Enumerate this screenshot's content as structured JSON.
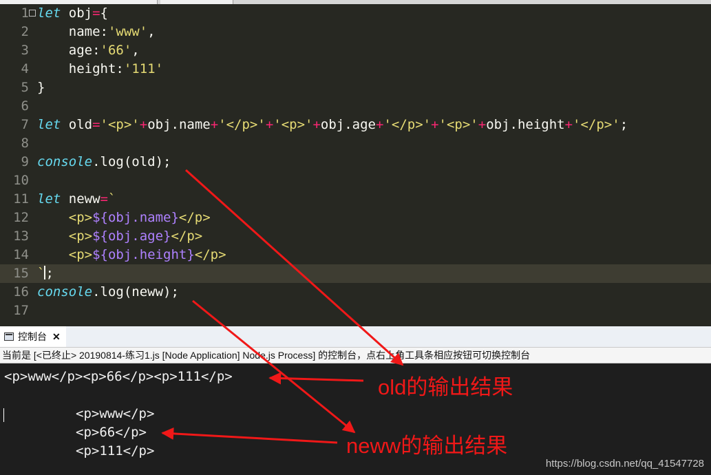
{
  "editor": {
    "lines": [
      {
        "num": "1",
        "tokens": [
          {
            "t": "kw",
            "v": "let"
          },
          {
            "t": "pl",
            "v": " obj"
          },
          {
            "t": "op",
            "v": "="
          },
          {
            "t": "pl",
            "v": "{"
          }
        ]
      },
      {
        "num": "2",
        "tokens": [
          {
            "t": "pl",
            "v": "    name:"
          },
          {
            "t": "str",
            "v": "'www'"
          },
          {
            "t": "pl",
            "v": ","
          }
        ]
      },
      {
        "num": "3",
        "tokens": [
          {
            "t": "pl",
            "v": "    age:"
          },
          {
            "t": "str",
            "v": "'66'"
          },
          {
            "t": "pl",
            "v": ","
          }
        ]
      },
      {
        "num": "4",
        "tokens": [
          {
            "t": "pl",
            "v": "    height:"
          },
          {
            "t": "str",
            "v": "'111'"
          }
        ]
      },
      {
        "num": "5",
        "tokens": [
          {
            "t": "pl",
            "v": "}"
          }
        ]
      },
      {
        "num": "6",
        "tokens": []
      },
      {
        "num": "7",
        "tokens": [
          {
            "t": "kw",
            "v": "let"
          },
          {
            "t": "pl",
            "v": " old"
          },
          {
            "t": "op",
            "v": "="
          },
          {
            "t": "str",
            "v": "'<p>'"
          },
          {
            "t": "op",
            "v": "+"
          },
          {
            "t": "pl",
            "v": "obj.name"
          },
          {
            "t": "op",
            "v": "+"
          },
          {
            "t": "str",
            "v": "'</p>'"
          },
          {
            "t": "op",
            "v": "+"
          },
          {
            "t": "str",
            "v": "'<p>'"
          },
          {
            "t": "op",
            "v": "+"
          },
          {
            "t": "pl",
            "v": "obj.age"
          },
          {
            "t": "op",
            "v": "+"
          },
          {
            "t": "str",
            "v": "'</p>'"
          },
          {
            "t": "op",
            "v": "+"
          },
          {
            "t": "str",
            "v": "'<p>'"
          },
          {
            "t": "op",
            "v": "+"
          },
          {
            "t": "pl",
            "v": "obj.height"
          },
          {
            "t": "op",
            "v": "+"
          },
          {
            "t": "str",
            "v": "'</p>'"
          },
          {
            "t": "pl",
            "v": ";"
          }
        ]
      },
      {
        "num": "8",
        "tokens": []
      },
      {
        "num": "9",
        "tokens": [
          {
            "t": "kw",
            "v": "console"
          },
          {
            "t": "pl",
            "v": ".log(old);"
          }
        ]
      },
      {
        "num": "10",
        "tokens": []
      },
      {
        "num": "11",
        "tokens": [
          {
            "t": "kw",
            "v": "let"
          },
          {
            "t": "pl",
            "v": " neww"
          },
          {
            "t": "op",
            "v": "="
          },
          {
            "t": "str",
            "v": "`"
          }
        ]
      },
      {
        "num": "12",
        "tokens": [
          {
            "t": "str",
            "v": "    <p>"
          },
          {
            "t": "sub",
            "v": "${obj.name}"
          },
          {
            "t": "str",
            "v": "</p>"
          }
        ]
      },
      {
        "num": "13",
        "tokens": [
          {
            "t": "str",
            "v": "    <p>"
          },
          {
            "t": "sub",
            "v": "${obj.age}"
          },
          {
            "t": "str",
            "v": "</p>"
          }
        ]
      },
      {
        "num": "14",
        "tokens": [
          {
            "t": "str",
            "v": "    <p>"
          },
          {
            "t": "sub",
            "v": "${obj.height}"
          },
          {
            "t": "str",
            "v": "</p>"
          }
        ]
      },
      {
        "num": "15",
        "tokens": [
          {
            "t": "str",
            "v": "`"
          },
          {
            "t": "pl",
            "v": ";"
          }
        ],
        "current": true
      },
      {
        "num": "16",
        "tokens": [
          {
            "t": "kw",
            "v": "console"
          },
          {
            "t": "pl",
            "v": ".log(neww);"
          }
        ]
      },
      {
        "num": "17",
        "tokens": []
      }
    ]
  },
  "console": {
    "tab_label": "控制台",
    "tab_close": "✕",
    "tab_icon": "console-window-icon",
    "status": "当前是 [<已终止> 20190814-练习1.js [Node Application] Node.js Process] 的控制台，点右上角工具条相应按钮可切换控制台",
    "old_output": "<p>www</p><p>66</p><p>111</p>",
    "neww_output": [
      "<p>www</p>",
      "<p>66</p>",
      "<p>111</p>"
    ]
  },
  "annotations": {
    "old_label": "old的输出结果",
    "neww_label": "neww的输出结果",
    "color": "#f01818"
  },
  "watermark": "https://blog.csdn.net/qq_41547728",
  "colors": {
    "editor_bg": "#272822",
    "keyword": "#66d9ef",
    "operator": "#f92672",
    "string": "#e6db74",
    "substitution": "#ae81ff",
    "plain": "#f8f8f2"
  }
}
